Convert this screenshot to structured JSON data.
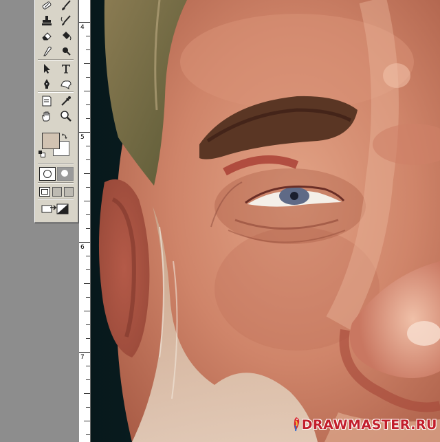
{
  "ruler": {
    "labels": [
      "4",
      "5",
      "6",
      "7"
    ]
  },
  "toolbox": {
    "tools": [
      "eraser-spot-icon",
      "brush-icon",
      "stamp-icon",
      "history-brush-icon",
      "eraser-icon",
      "paint-bucket-icon",
      "smudge-icon",
      "burn-icon",
      "path-select-icon",
      "type-icon",
      "pen-icon",
      "custom-shape-icon",
      "notes-icon",
      "eyedropper-icon",
      "hand-icon",
      "zoom-icon"
    ],
    "foreground_color": "#d2c3b2",
    "background_color": "#ffffff"
  },
  "watermark": {
    "text": "DRAWMASTER.RU"
  },
  "colors": {
    "workspace": "#8d8d8d",
    "toolbox": "#d8d4c8",
    "canvas_background": "#0d2124",
    "skin": "#c97a62",
    "hair": "#7a6a44",
    "eyebrow": "#5a3624",
    "iris": "#5f6a86"
  }
}
